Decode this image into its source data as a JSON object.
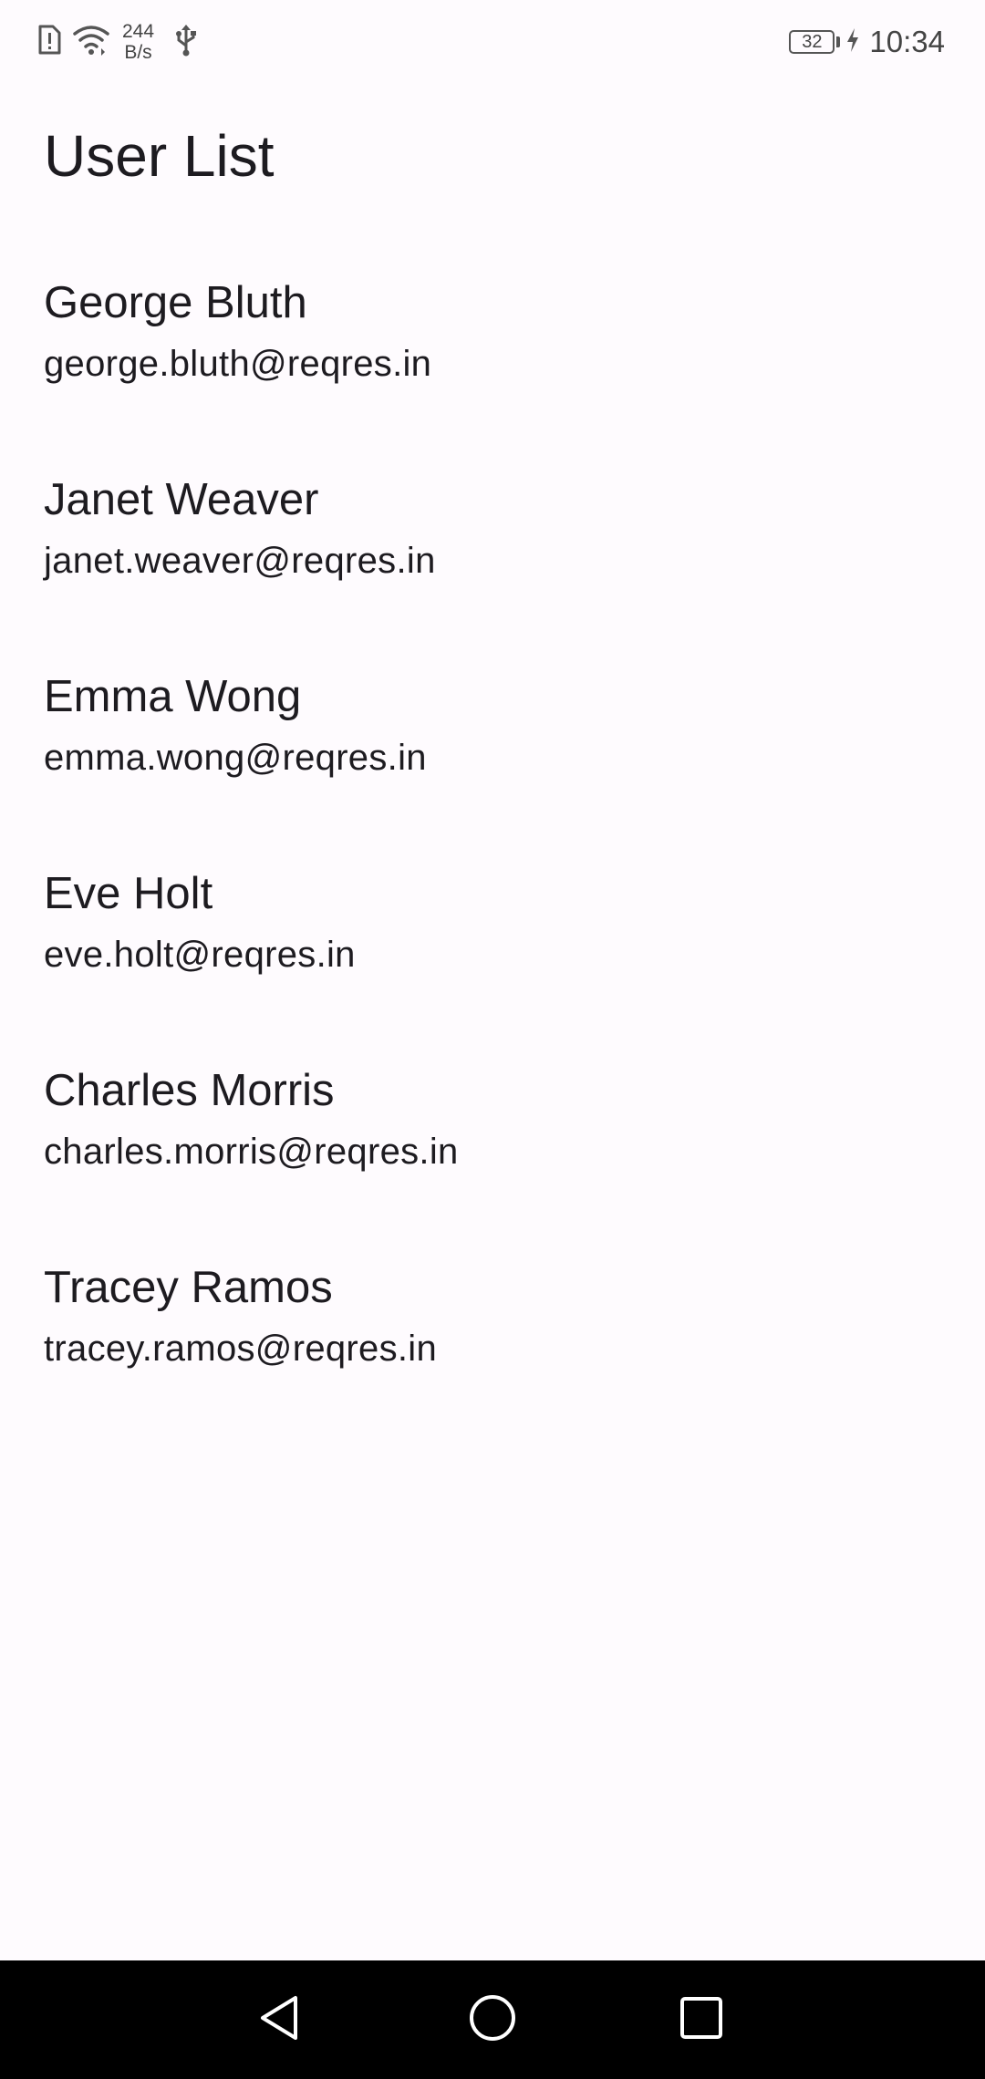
{
  "status_bar": {
    "net_speed_value": "244",
    "net_speed_unit": "B/s",
    "battery_level": "32",
    "time": "10:34",
    "icons": [
      "sim-alert-icon",
      "wifi-icon",
      "usb-icon",
      "battery-icon",
      "charging-bolt-icon"
    ]
  },
  "page": {
    "title": "User List"
  },
  "users": [
    {
      "name": "George Bluth",
      "email": "george.bluth@reqres.in"
    },
    {
      "name": "Janet Weaver",
      "email": "janet.weaver@reqres.in"
    },
    {
      "name": "Emma Wong",
      "email": "emma.wong@reqres.in"
    },
    {
      "name": "Eve Holt",
      "email": "eve.holt@reqres.in"
    },
    {
      "name": "Charles Morris",
      "email": "charles.morris@reqres.in"
    },
    {
      "name": "Tracey Ramos",
      "email": "tracey.ramos@reqres.in"
    }
  ],
  "nav_bar": {
    "buttons": [
      "back-icon",
      "home-icon",
      "recents-icon"
    ]
  },
  "colors": {
    "background": "#fefbfe",
    "text": "#1d1b20",
    "nav_background": "#000000"
  }
}
